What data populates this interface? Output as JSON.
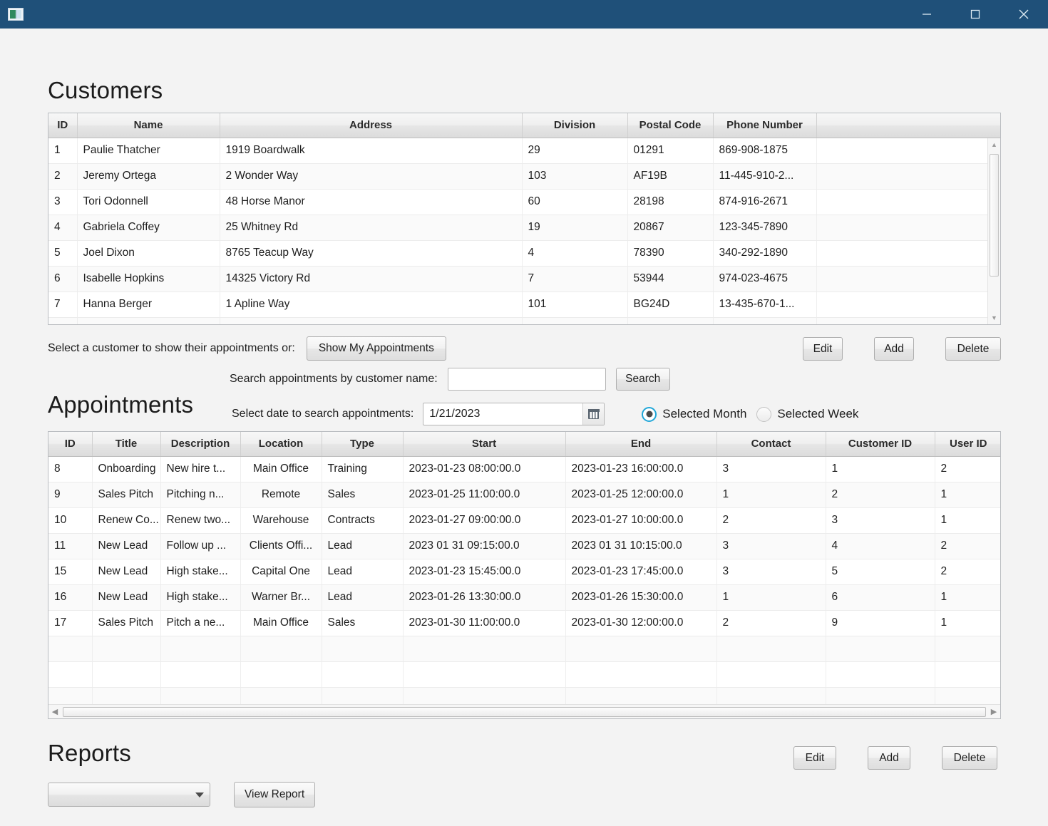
{
  "window": {
    "icon": "app-window-icon",
    "minimize": "minimize-icon",
    "maximize": "maximize-icon",
    "close": "close-icon",
    "titlebar_color": "#1f5079"
  },
  "customers": {
    "heading": "Customers",
    "columns": [
      "ID",
      "Name",
      "Address",
      "Division",
      "Postal Code",
      "Phone Number",
      ""
    ],
    "rows": [
      {
        "id": "1",
        "name": "Paulie Thatcher",
        "address": "1919 Boardwalk",
        "division": "29",
        "postal": "01291",
        "phone": "869-908-1875"
      },
      {
        "id": "2",
        "name": "Jeremy Ortega",
        "address": "2 Wonder Way",
        "division": "103",
        "postal": "AF19B",
        "phone": "11-445-910-2..."
      },
      {
        "id": "3",
        "name": "Tori Odonnell",
        "address": "48 Horse Manor",
        "division": "60",
        "postal": "28198",
        "phone": "874-916-2671"
      },
      {
        "id": "4",
        "name": "Gabriela Coffey",
        "address": "25 Whitney Rd",
        "division": "19",
        "postal": "20867",
        "phone": "123-345-7890"
      },
      {
        "id": "5",
        "name": "Joel Dixon",
        "address": "8765 Teacup Way",
        "division": "4",
        "postal": "78390",
        "phone": "340-292-1890"
      },
      {
        "id": "6",
        "name": "Isabelle Hopkins",
        "address": "14325 Victory Rd",
        "division": "7",
        "postal": "53944",
        "phone": "974-023-4675"
      },
      {
        "id": "7",
        "name": "Hanna Berger",
        "address": "1 Apline Way",
        "division": "101",
        "postal": "BG24D",
        "phone": "13-435-670-1..."
      }
    ]
  },
  "customer_actions": {
    "select_hint": "Select a customer to show their appointments or:",
    "show_my_appointments": "Show My Appointments",
    "edit": "Edit",
    "add": "Add",
    "delete": "Delete"
  },
  "appointments": {
    "heading": "Appointments",
    "search_label": "Search appointments by customer name:",
    "search_value": "",
    "search_placeholder": "",
    "search_button": "Search",
    "date_label": "Select date to search appointments:",
    "date_value": "1/21/2023",
    "calendar_icon": "calendar-icon",
    "range_options": [
      {
        "label": "Selected Month",
        "selected": true
      },
      {
        "label": "Selected Week",
        "selected": false
      }
    ],
    "columns": [
      "ID",
      "Title",
      "Description",
      "Location",
      "Type",
      "Start",
      "End",
      "Contact",
      "Customer ID",
      "User ID"
    ],
    "rows": [
      {
        "id": "8",
        "title": "Onboarding",
        "description": "New hire t...",
        "location": "Main Office",
        "type": "Training",
        "start": "2023-01-23 08:00:00.0",
        "end": "2023-01-23 16:00:00.0",
        "contact": "3",
        "customer_id": "1",
        "user_id": "2"
      },
      {
        "id": "9",
        "title": "Sales Pitch",
        "description": "Pitching n...",
        "location": "Remote",
        "type": "Sales",
        "start": "2023-01-25 11:00:00.0",
        "end": "2023-01-25 12:00:00.0",
        "contact": "1",
        "customer_id": "2",
        "user_id": "1"
      },
      {
        "id": "10",
        "title": "Renew Co...",
        "description": "Renew two...",
        "location": "Warehouse",
        "type": "Contracts",
        "start": "2023-01-27 09:00:00.0",
        "end": "2023-01-27 10:00:00.0",
        "contact": "2",
        "customer_id": "3",
        "user_id": "1"
      },
      {
        "id": "11",
        "title": "New Lead",
        "description": "Follow up ...",
        "location": "Clients Offi...",
        "type": "Lead",
        "start": "2023 01 31 09:15:00.0",
        "end": "2023 01 31 10:15:00.0",
        "contact": "3",
        "customer_id": "4",
        "user_id": "2"
      },
      {
        "id": "15",
        "title": "New Lead",
        "description": "High stake...",
        "location": "Capital One",
        "type": "Lead",
        "start": "2023-01-23 15:45:00.0",
        "end": "2023-01-23 17:45:00.0",
        "contact": "3",
        "customer_id": "5",
        "user_id": "2"
      },
      {
        "id": "16",
        "title": "New Lead",
        "description": "High stake...",
        "location": "Warner Br...",
        "type": "Lead",
        "start": "2023-01-26 13:30:00.0",
        "end": "2023-01-26 15:30:00.0",
        "contact": "1",
        "customer_id": "6",
        "user_id": "1"
      },
      {
        "id": "17",
        "title": "Sales Pitch",
        "description": "Pitch a ne...",
        "location": "Main Office",
        "type": "Sales",
        "start": "2023-01-30 11:00:00.0",
        "end": "2023-01-30 12:00:00.0",
        "contact": "2",
        "customer_id": "9",
        "user_id": "1"
      }
    ],
    "empty_rows": 3
  },
  "appointment_actions": {
    "edit": "Edit",
    "add": "Add",
    "delete": "Delete"
  },
  "reports": {
    "heading": "Reports",
    "selected_value": "",
    "view_report": "View Report",
    "caret_icon": "chevron-down-icon"
  }
}
